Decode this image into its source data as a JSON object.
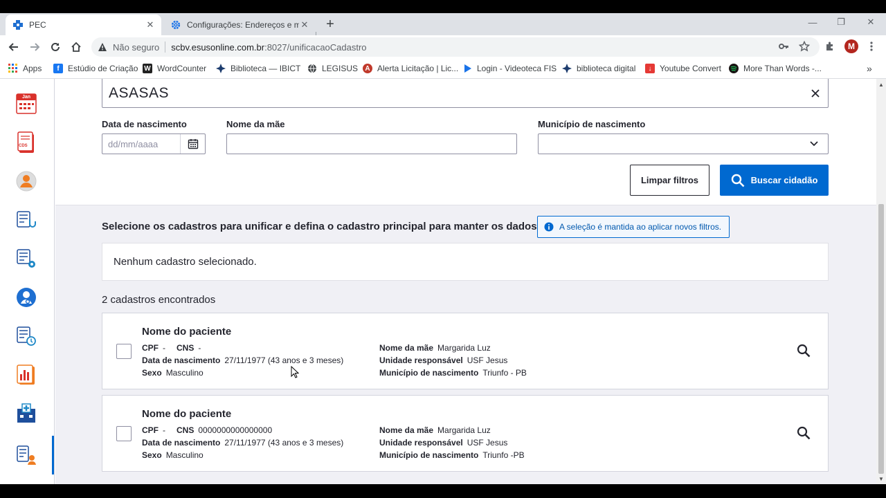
{
  "browser": {
    "tabs": [
      {
        "title": "PEC",
        "close": "✕",
        "icon": "pec-icon"
      },
      {
        "title": "Configurações: Endereços e mais",
        "close": "✕",
        "icon": "gear-icon"
      }
    ],
    "new_tab": "+",
    "window_controls": {
      "minimize": "—",
      "restore": "❐",
      "close": "✕"
    },
    "omnibox": {
      "security": "Não seguro",
      "url_host": "scbv.esusonline.com.br",
      "url_path": ":8027/unificacaoCadastro"
    },
    "profile_initial": "M",
    "bookmarks": [
      {
        "label": "Apps",
        "icon": "apps-grid-icon"
      },
      {
        "label": "Estúdio de Criação",
        "icon": "facebook-icon"
      },
      {
        "label": "WordCounter",
        "icon": "wordcounter-icon"
      },
      {
        "label": "Biblioteca — IBICT",
        "icon": "ibict-icon"
      },
      {
        "label": "LEGISUS",
        "icon": "globe-icon"
      },
      {
        "label": "Alerta Licitação | Lic...",
        "icon": "alerta-icon"
      },
      {
        "label": "Login - Videoteca FIS",
        "icon": "play-icon"
      },
      {
        "label": "biblioteca digital",
        "icon": "ibict-icon"
      },
      {
        "label": "Youtube Convert",
        "icon": "download-icon"
      },
      {
        "label": "More Than Words -...",
        "icon": "spotify-icon"
      }
    ],
    "bookmarks_more": "»"
  },
  "filters": {
    "name_value": "ASASAS",
    "birth_label": "Data de nascimento",
    "birth_placeholder": "dd/mm/aaaa",
    "mother_label": "Nome da mãe",
    "mother_value": "",
    "city_label": "Município de nascimento",
    "city_value": "",
    "clear_button": "Limpar filtros",
    "search_button": "Buscar cidadão"
  },
  "selection": {
    "title": "Selecione os cadastros para unificar e defina o cadastro principal para manter os dados",
    "info": "A seleção é mantida ao aplicar novos filtros.",
    "empty": "Nenhum cadastro selecionado.",
    "found": "2 cadastros encontrados"
  },
  "labels": {
    "cpf": "CPF",
    "cns": "CNS",
    "birth": "Data de nascimento",
    "sex": "Sexo",
    "mother": "Nome da mãe",
    "unit": "Unidade responsável",
    "city": "Município de nascimento"
  },
  "records": [
    {
      "name": "Nome do paciente",
      "cpf": "-",
      "cns": "-",
      "birth": "27/11/1977",
      "age": "(43 anos e 3 meses)",
      "sex": "Masculino",
      "mother": "Margarida Luz",
      "unit": "USF Jesus",
      "city": "Triunfo - PB"
    },
    {
      "name": "Nome do paciente",
      "cpf": "-",
      "cns": "0000000000000000",
      "birth": "27/11/1977",
      "age": "(43 anos e 3 meses)",
      "sex": "Masculino",
      "mother": "Margarida Luz",
      "unit": "USF Jesus",
      "city": "Triunfo -PB"
    }
  ],
  "sidebar": {
    "calendar_month": "Jan",
    "cds_label": "CDS"
  },
  "colors": {
    "primary": "#0069d0",
    "text": "#24252e",
    "border": "#8f8fa2"
  }
}
